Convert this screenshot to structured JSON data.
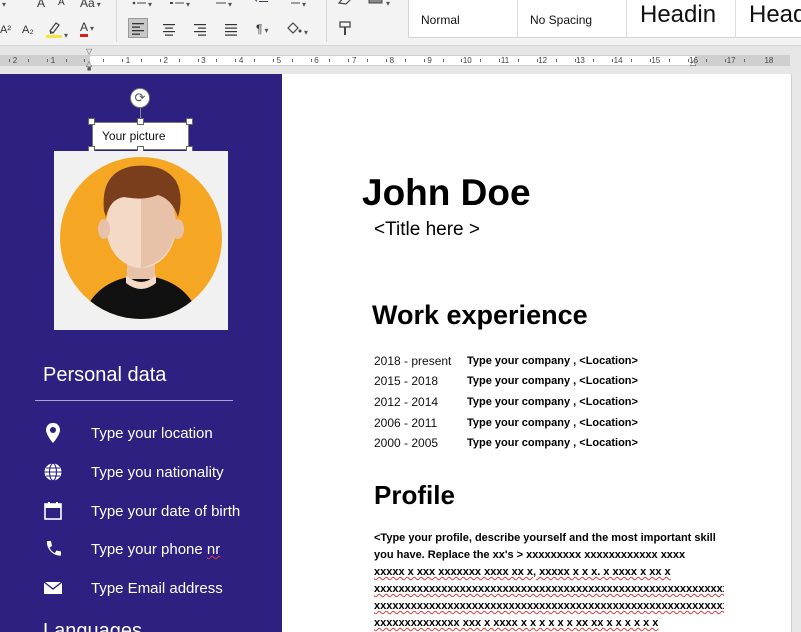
{
  "ribbon": {
    "font_size_buttons": [
      "A",
      "A"
    ],
    "change_case_label": "Aa",
    "superscript_label": "A²",
    "subscript_label": "A₂",
    "font_color_label": "A",
    "highlight_color": "#f5e63b",
    "font_color": "#d42020",
    "style_gallery": [
      "Normal",
      "No Spacing",
      "Headin",
      "Head"
    ]
  },
  "ruler": {
    "left_numbers": [
      "2",
      "1"
    ],
    "right_numbers": [
      "1",
      "2",
      "3",
      "4",
      "5",
      "6",
      "7",
      "8",
      "9",
      "10",
      "11",
      "12",
      "13",
      "14",
      "15",
      "16",
      "17",
      "18"
    ]
  },
  "sidebar": {
    "bg_color": "#2e2080",
    "picture_caption": "Your picture",
    "personal_title": "Personal data",
    "items": [
      {
        "icon": "location-pin-icon",
        "text": "Type your location"
      },
      {
        "icon": "globe-icon",
        "text": "Type you nationality"
      },
      {
        "icon": "calendar-icon",
        "text": "Type your date of birth"
      },
      {
        "icon": "phone-icon",
        "text_main": "Type your phone ",
        "text_flag": "nr"
      },
      {
        "icon": "envelope-icon",
        "text": "Type Email address"
      }
    ],
    "languages_title": "Languages"
  },
  "main": {
    "name": "John Doe",
    "title": "<Title here >",
    "work_title": "Work experience",
    "jobs": [
      {
        "years": "2018 - present",
        "company": "Type your company , <Location>"
      },
      {
        "years": "2015 - 2018",
        "company": "Type your company , <Location>"
      },
      {
        "years": "2012 - 2014",
        "company": "Type your company , <Location>"
      },
      {
        "years": "2006 - 2011",
        "company": "Type your company , <Location>"
      },
      {
        "years": "2000 - 2005",
        "company": "Type your company , <Location>"
      }
    ],
    "profile_title": "Profile",
    "profile_lines": [
      "<Type your profile, describe yourself and the most important skill",
      "you have.  Replace the xx's >        xxxxxxxxx xxxxxxxxxxxx  xxxx",
      "xxxxx x xxx xxxxxxx xxxx xx x, xxxxx x x x. x xxxx x xx x",
      "xxxxxxxxxxxxxxxxxxxxxxxxxxxxxxxxxxxxxxxxxxxxxxxxxxxxxxxxxxxxxx",
      "xxxxxxxxxxxxxxxxxxxxxxxxxxxxxxxxxxxxxxxxxxxxxxxxxxxxxxxxxxxxxx",
      "xxxxxxxxxxxxxx xxx  x xxxx x  x x x x x xx  xx x x x x x x"
    ]
  }
}
